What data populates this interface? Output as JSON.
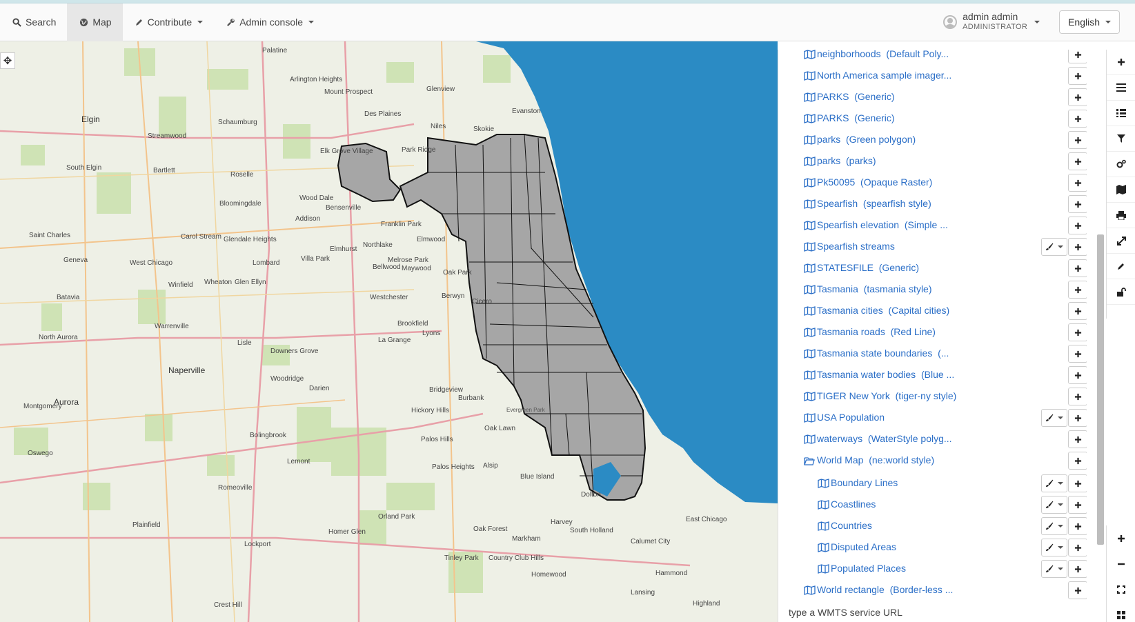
{
  "navbar": {
    "search_label": "Search",
    "map_label": "Map",
    "contribute_label": "Contribute",
    "admin_label": "Admin console",
    "user_name": "admin admin",
    "user_role": "ADMINISTRATOR",
    "language": "English"
  },
  "map": {
    "labels": [
      "Palatine",
      "Elgin",
      "Schaumburg",
      "Arlington Heights",
      "Mount Prospect",
      "Glenview",
      "Des Plaines",
      "Evanston",
      "Niles",
      "Skokie",
      "Park Ridge",
      "Elk Grove Village",
      "South Elgin",
      "Bartlett",
      "Roselle",
      "Streamwood",
      "Bloomingdale",
      "Wood Dale",
      "Bensenville",
      "Franklin Park",
      "Elmwood",
      "Northlake",
      "Melrose Park",
      "Oak Park",
      "Saint Charles",
      "Carol Stream",
      "Glendale Heights",
      "Addison",
      "Elmhurst",
      "Villa Park",
      "Lombard",
      "Glen Ellyn",
      "West Chicago",
      "Geneva",
      "Winfield",
      "Wheaton",
      "Batavia",
      "Bellwood",
      "Maywood",
      "Westchester",
      "Berwyn",
      "Cicero",
      "Brookfield",
      "La Grange",
      "Lyons",
      "Warrenville",
      "North Aurora",
      "Lisle",
      "Downers Grove",
      "Naperville",
      "Aurora",
      "Woodridge",
      "Darien",
      "Bridgeview",
      "Burbank",
      "Hickory Hills",
      "Evergreen Park",
      "Oak Lawn",
      "Palos Hills",
      "Bolingbrook",
      "Montgomery",
      "Oswego",
      "Lemont",
      "Palos Heights",
      "Alsip",
      "Blue Island",
      "Dolton",
      "Romeoville",
      "Plainfield",
      "Homer Glen",
      "Lockport",
      "Orland Park",
      "Oak Forest",
      "Harvey",
      "South Holland",
      "Markham",
      "Tinley Park",
      "Country Club Hills",
      "Homewood",
      "Calumet City",
      "Hammond",
      "Lansing",
      "East Chicago",
      "Highland",
      "Crest Hill"
    ]
  },
  "panel": {
    "layers": [
      {
        "name": "neighborhoods",
        "style": "(Default Poly..."
      },
      {
        "name": "North America sample imager...",
        "style": ""
      },
      {
        "name": "PARKS",
        "style": "(Generic)"
      },
      {
        "name": "PARKS",
        "style": "(Generic)"
      },
      {
        "name": "parks",
        "style": "(Green polygon)"
      },
      {
        "name": "parks",
        "style": "(parks)"
      },
      {
        "name": "Pk50095",
        "style": "(Opaque Raster)"
      },
      {
        "name": "Spearfish",
        "style": "(spearfish style)"
      },
      {
        "name": "Spearfish elevation",
        "style": "(Simple ..."
      },
      {
        "name": "Spearfish streams",
        "style": ""
      },
      {
        "name": "STATESFILE",
        "style": "(Generic)"
      },
      {
        "name": "Tasmania",
        "style": "(tasmania style)"
      },
      {
        "name": "Tasmania cities",
        "style": "(Capital cities)"
      },
      {
        "name": "Tasmania roads",
        "style": "(Red Line)"
      },
      {
        "name": "Tasmania state boundaries",
        "style": "(..."
      },
      {
        "name": "Tasmania water bodies",
        "style": "(Blue ..."
      },
      {
        "name": "TIGER New York",
        "style": "(tiger-ny style)"
      },
      {
        "name": "USA Population",
        "style": ""
      },
      {
        "name": "waterways",
        "style": "(WaterStyle polyg..."
      },
      {
        "name": "World Map",
        "style": "(ne:world style)"
      },
      {
        "name": "Boundary Lines",
        "style": ""
      },
      {
        "name": "Coastlines",
        "style": ""
      },
      {
        "name": "Countries",
        "style": ""
      },
      {
        "name": "Disputed Areas",
        "style": ""
      },
      {
        "name": "Populated Places",
        "style": ""
      },
      {
        "name": "World rectangle",
        "style": "(Border-less ..."
      }
    ],
    "wmts_placeholder": "type a WMTS service URL"
  },
  "colors": {
    "link": "#2a6ec7",
    "lake": "#2b8bc4",
    "city": "#a6a6a6",
    "land": "#eef0e6"
  },
  "icons": [
    "search-icon",
    "globe-icon",
    "pencil-icon",
    "wrench-icon",
    "user-icon",
    "map-icon",
    "folder-open-icon",
    "brush-icon",
    "plus-icon",
    "minus-icon"
  ]
}
